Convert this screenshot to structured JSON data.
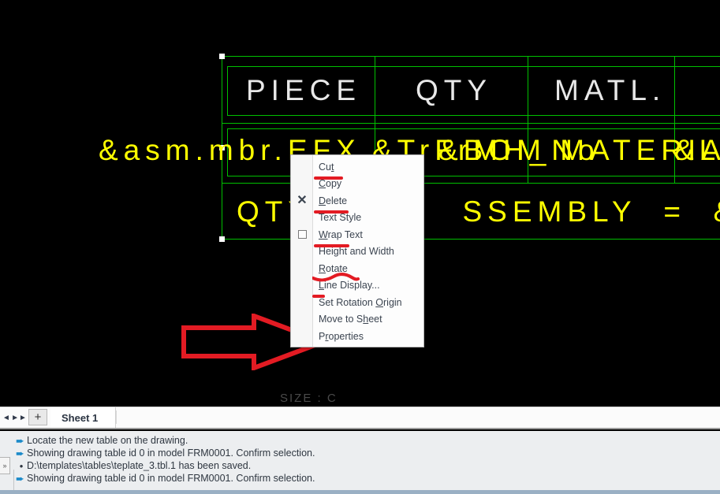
{
  "canvas": {
    "table": {
      "header_cells": [
        "PIECE",
        "QTY",
        "MATL."
      ],
      "param_row": [
        "&asm.mbr.EFX",
        "&TrFrMH_No",
        "&BOM MATERIAL",
        "&Lc"
      ],
      "param_row_overlap_text": "&asm.mbr.EFX  I&TrFrMH_No&BOMMATERIA&Lc",
      "qty_row_text": "QTY PER ASSEMBLY = &TOTQ",
      "qty_row_visible": "QTY           SSEMBLY  =  &TOTQ"
    },
    "size_label": "SIZE : C",
    "colors": {
      "background": "#000000",
      "grid": "#00c000",
      "header_text": "#e8e8e8",
      "parameter_text": "#ffff00",
      "handle": "#ffffff",
      "annotation": "#e31b23"
    }
  },
  "context_menu": {
    "items": [
      {
        "label_pre": "Cu",
        "mnemonic": "t",
        "label_post": "",
        "icon": ""
      },
      {
        "label_pre": "",
        "mnemonic": "C",
        "label_post": "opy",
        "icon": ""
      },
      {
        "label_pre": "",
        "mnemonic": "D",
        "label_post": "elete",
        "icon": "x-icon"
      },
      {
        "label_pre": "Text Style",
        "mnemonic": "",
        "label_post": "",
        "icon": ""
      },
      {
        "label_pre": "",
        "mnemonic": "W",
        "label_post": "rap Text",
        "icon": "checkbox-icon"
      },
      {
        "label_pre": "Height and Width",
        "mnemonic": "",
        "label_post": "",
        "icon": ""
      },
      {
        "label_pre": "",
        "mnemonic": "R",
        "label_post": "otate",
        "icon": ""
      },
      {
        "label_pre": "",
        "mnemonic": "L",
        "label_post": "ine Display...",
        "icon": ""
      },
      {
        "label_pre": "Set Rotation ",
        "mnemonic": "O",
        "label_post": "rigin",
        "icon": ""
      },
      {
        "label_pre": "Move to S",
        "mnemonic": "h",
        "label_post": "eet",
        "icon": ""
      },
      {
        "label_pre": "P",
        "mnemonic": "r",
        "label_post": "operties",
        "icon": ""
      }
    ]
  },
  "tabbar": {
    "nav_first": "◄◄",
    "nav_prev": "◄",
    "nav_next": "►►",
    "add_label": "+",
    "sheet_tab": "Sheet 1"
  },
  "messages": {
    "collapse_label": "»",
    "rows": [
      {
        "marker": "arrow",
        "text": "Locate the new table on the drawing."
      },
      {
        "marker": "arrow",
        "text": "Showing drawing table id 0 in model FRM0001. Confirm selection."
      },
      {
        "marker": "dot",
        "text": "D:\\templates\\tables\\teplate_3.tbl.1 has been saved."
      },
      {
        "marker": "arrow",
        "text": "Showing drawing table id 0 in model FRM0001. Confirm selection."
      }
    ]
  }
}
